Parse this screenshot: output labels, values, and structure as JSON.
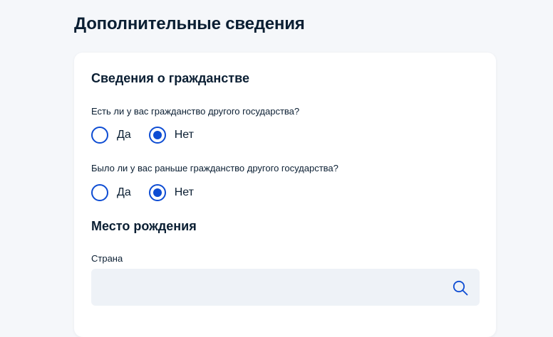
{
  "page": {
    "title": "Дополнительные сведения"
  },
  "citizenship": {
    "title": "Сведения о гражданстве",
    "questions": [
      {
        "label": "Есть ли у вас гражданство другого государства?",
        "options": [
          "Да",
          "Нет"
        ],
        "selected": "Нет"
      },
      {
        "label": "Было ли у вас раньше гражданство другого государства?",
        "options": [
          "Да",
          "Нет"
        ],
        "selected": "Нет"
      }
    ]
  },
  "birthplace": {
    "title": "Место рождения",
    "country": {
      "label": "Страна",
      "value": "",
      "placeholder": ""
    }
  },
  "icons": {
    "search": "search-icon"
  },
  "colors": {
    "accent": "#0d4cd3",
    "text": "#0b1f33",
    "background": "#f5f7fa",
    "card": "#ffffff",
    "input_background": "#eef2f7"
  }
}
